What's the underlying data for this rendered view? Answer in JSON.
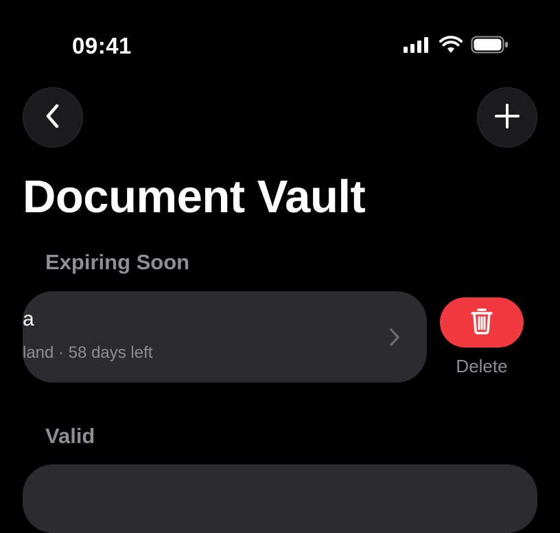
{
  "status_bar": {
    "time": "09:41",
    "icons": [
      "signal-icon",
      "wifi-icon",
      "battery-icon"
    ]
  },
  "nav": {
    "back_icon": "chevron-left-icon",
    "add_icon": "plus-icon"
  },
  "page": {
    "title": "Document Vault"
  },
  "sections": [
    {
      "header": "Expiring Soon",
      "items": [
        {
          "title_visible": "a",
          "subtitle_visible": "land · 58 days left",
          "chevron_icon": "chevron-right-icon"
        }
      ]
    },
    {
      "header": "Valid",
      "items": []
    }
  ],
  "swipe_action": {
    "icon": "trash-icon",
    "label": "Delete",
    "color": "#f2393f"
  },
  "colors": {
    "background": "#000000",
    "card": "#2c2c2e",
    "secondary_text": "#8e8e93",
    "destructive": "#f2393f"
  }
}
